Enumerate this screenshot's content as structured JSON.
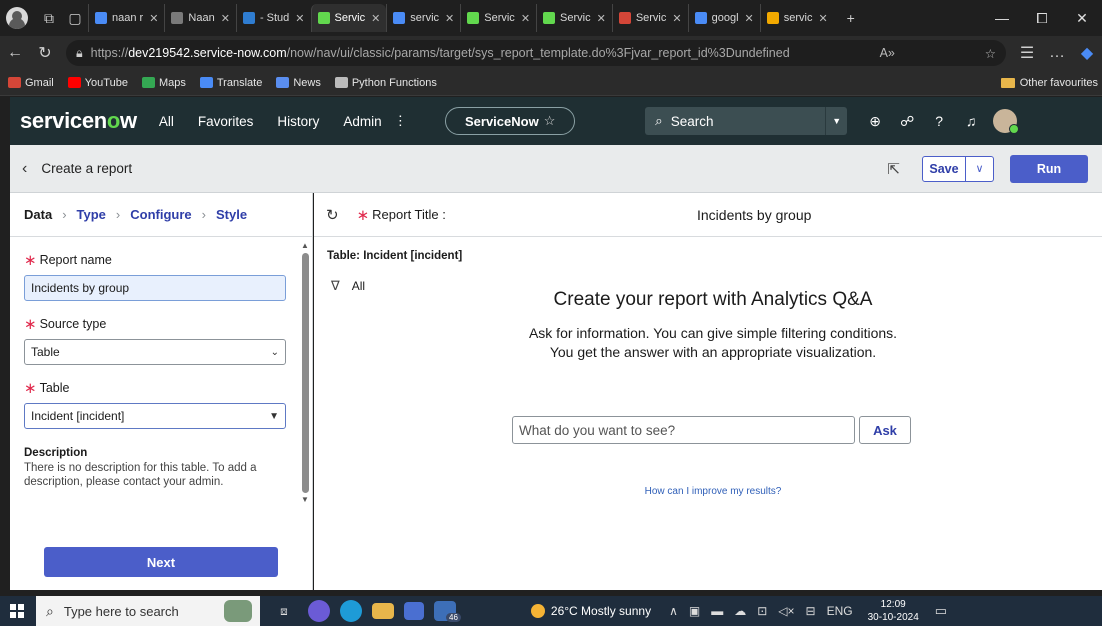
{
  "browser": {
    "tabs": [
      {
        "label": "naan r",
        "color": "#4a8bf5"
      },
      {
        "label": "Naan",
        "color": "#7a7a7a"
      },
      {
        "label": "- Stud",
        "color": "#2f7dd1"
      },
      {
        "label": "Servic",
        "color": "#62d84e",
        "active": true
      },
      {
        "label": "servic",
        "color": "#4a8bf5"
      },
      {
        "label": "Servic",
        "color": "#62d84e"
      },
      {
        "label": "Servic",
        "color": "#62d84e"
      },
      {
        "label": "Servic",
        "color": "#d44638"
      },
      {
        "label": "googl",
        "color": "#4a8bf5"
      },
      {
        "label": "servic",
        "color": "#f2a900"
      }
    ],
    "url_prefix": "https://",
    "url_host": "dev219542.service-now.com",
    "url_path": "/now/nav/ui/classic/params/target/sys_report_template.do%3Fjvar_report_id%3Dundefined",
    "bookmarks": [
      {
        "label": "Gmail",
        "color": "#d44638"
      },
      {
        "label": "YouTube",
        "color": "#ff0000"
      },
      {
        "label": "Maps",
        "color": "#34a853"
      },
      {
        "label": "Translate",
        "color": "#4a8bf5"
      },
      {
        "label": "News",
        "color": "#5a8ef0"
      },
      {
        "label": "Python Functions",
        "color": "#bbbbbb"
      }
    ],
    "other_favourites": "Other favourites"
  },
  "header": {
    "logo_a": "servicen",
    "logo_o": "o",
    "logo_b": "w",
    "nav": {
      "all": "All",
      "favorites": "Favorites",
      "history": "History",
      "admin": "Admin",
      "more": "⋮"
    },
    "app_pill": "ServiceNow",
    "search_placeholder": "Search"
  },
  "titlebar": {
    "back": "‹",
    "title": "Create a report",
    "save": "Save",
    "run": "Run"
  },
  "steps": {
    "data": "Data",
    "type": "Type",
    "configure": "Configure",
    "style": "Style"
  },
  "form": {
    "report_name_label": "Report name",
    "report_name_value": "Incidents by group",
    "source_type_label": "Source type",
    "source_type_value": "Table",
    "table_label": "Table",
    "table_value": "Incident [incident]",
    "description_heading": "Description",
    "description_text": "There is no description for this table. To add a description, please contact your admin.",
    "next": "Next"
  },
  "report": {
    "title_label": "Report Title :",
    "title_value": "Incidents by group",
    "table_label": "Table: Incident [incident]",
    "filter": "All",
    "qa_title": "Create your report with Analytics Q&A",
    "qa_sub_1": "Ask for information. You can give simple filtering conditions.",
    "qa_sub_2": "You get the answer with an appropriate visualization.",
    "ask_placeholder": "What do you want to see?",
    "ask": "Ask",
    "improve": "How can I improve my results?"
  },
  "taskbar": {
    "search_placeholder": "Type here to search",
    "badge": "46",
    "weather": "26°C  Mostly sunny",
    "lang": "ENG",
    "time": "12:09",
    "date": "30-10-2024"
  },
  "colors": {
    "accent": "#4b5ec9",
    "header": "#1f2f33",
    "logo_green": "#62d84e",
    "required": "#e0294c"
  }
}
